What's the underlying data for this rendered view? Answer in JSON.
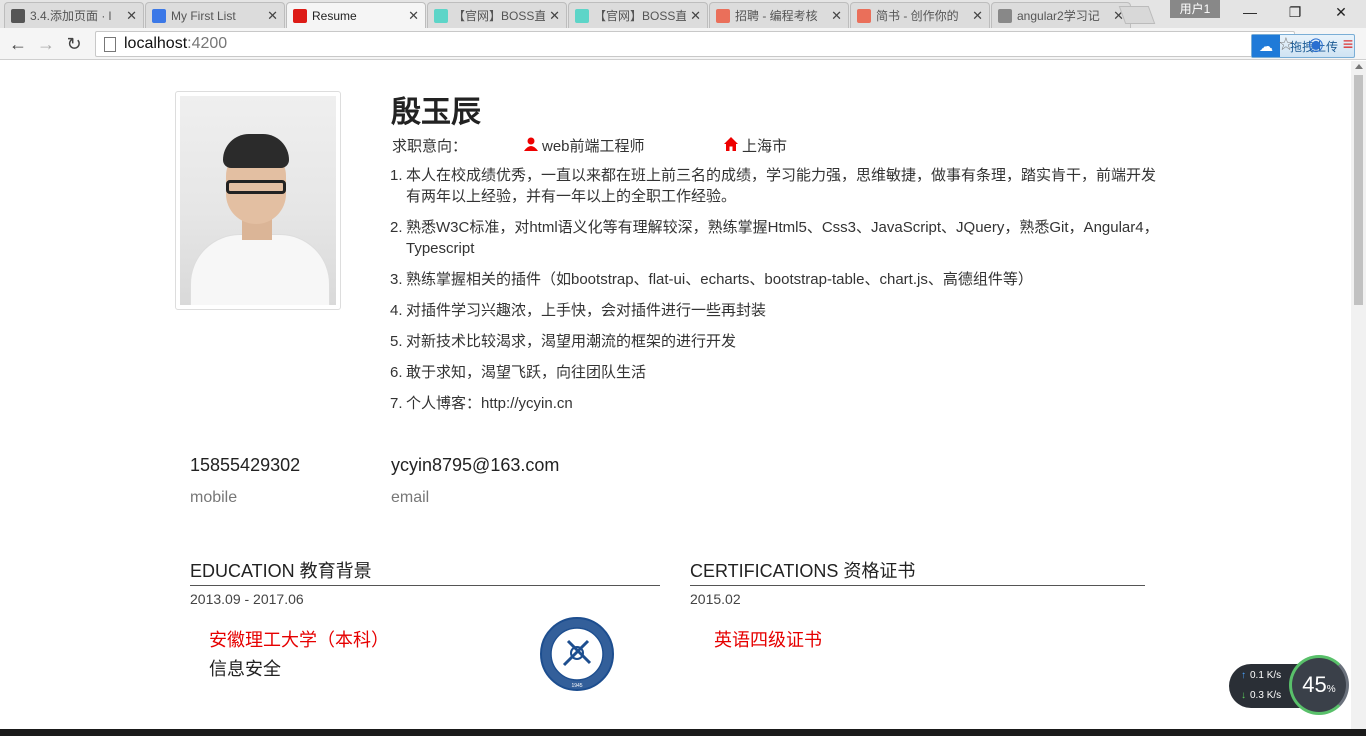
{
  "browser": {
    "tabs": [
      {
        "title": "3.4.添加页面 · l",
        "favicon": "book-icon",
        "color": "#555555"
      },
      {
        "title": "My First List",
        "favicon": "chrome-page-icon",
        "color": "#3b78e7"
      },
      {
        "title": "Resume",
        "favicon": "angular-icon",
        "color": "#dd1b16",
        "active": true
      },
      {
        "title": "【官网】BOSS直",
        "favicon": "boss-icon",
        "color": "#5dd5c8"
      },
      {
        "title": "【官网】BOSS直",
        "favicon": "boss-icon",
        "color": "#5dd5c8"
      },
      {
        "title": "招聘 - 编程考核",
        "favicon": "jianshu-icon",
        "color": "#ea6f5a"
      },
      {
        "title": "简书 - 创作你的",
        "favicon": "jianshu-icon",
        "color": "#ea6f5a"
      },
      {
        "title": "angular2学习记",
        "favicon": "avatar-icon",
        "color": "#888888"
      }
    ],
    "tab_close": "✕",
    "user_badge": "用户1",
    "url_host": "localhost",
    "url_port": ":4200",
    "upload_label": "拖拽上传"
  },
  "resume": {
    "name": "殷玉辰",
    "intent_label": "求职意向：",
    "job": "web前端工程师",
    "city": "上海市",
    "skills": [
      {
        "num": "1.",
        "text": "本人在校成绩优秀，一直以来都在班上前三名的成绩，学习能力强，思维敏捷，做事有条理，踏实肯干，前端开发有两年以上经验，并有一年以上的全职工作经验。"
      },
      {
        "num": "2.",
        "text": "熟悉W3C标准，对html语义化等有理解较深，熟练掌握Html5、Css3、JavaScript、JQuery，熟悉Git，Angular4，Typescript"
      },
      {
        "num": "3.",
        "text": "熟练掌握相关的插件（如bootstrap、flat-ui、echarts、bootstrap-table、chart.js、高德组件等）"
      },
      {
        "num": "4.",
        "text": "对插件学习兴趣浓，上手快，会对插件进行一些再封装"
      },
      {
        "num": "5.",
        "text": "对新技术比较渴求，渴望用潮流的框架的进行开发"
      },
      {
        "num": "6.",
        "text": "敢于求知，渴望飞跃，向往团队生活"
      },
      {
        "num": "7.",
        "text": "个人博客：http://ycyin.cn"
      }
    ],
    "phone": "15855429302",
    "phone_label": "mobile",
    "email": "ycyin8795@163.com",
    "email_label": "email",
    "education_title": "EDUCATION 教育背景",
    "education_date": "2013.09 - 2017.06",
    "school": "安徽理工大学（本科）",
    "major": "信息安全",
    "cert_title": "CERTIFICATIONS 资格证书",
    "cert_date": "2015.02",
    "cert_name": "英语四级证书",
    "seal_text": "ANHUI UNIVERSITY OF SCIENCE & TECHNOLOGY",
    "seal_year": "1945"
  },
  "net_widget": {
    "up": "0.1",
    "down": "0.3",
    "unit": "K/s",
    "percent": "45",
    "percent_sign": "%"
  }
}
